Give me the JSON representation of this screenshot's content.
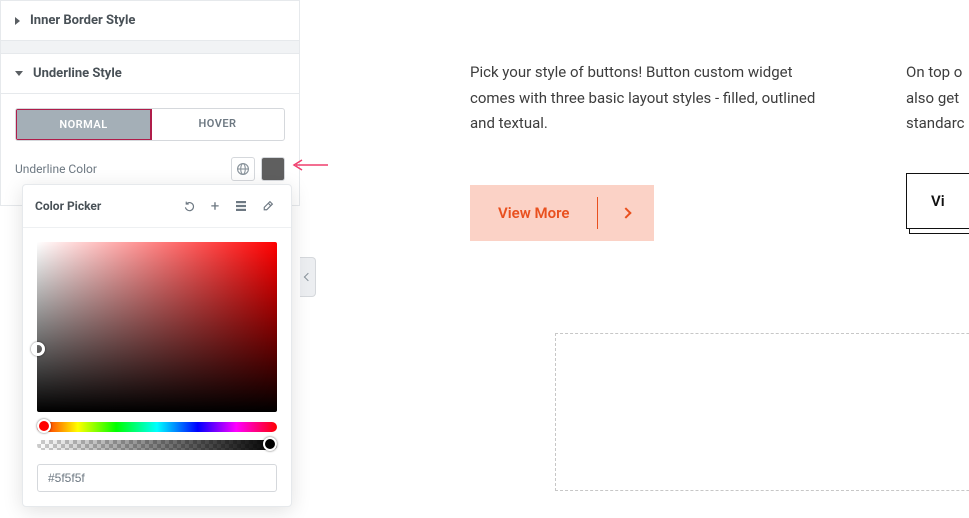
{
  "sidebar": {
    "section_inner_border": "Inner Border Style",
    "section_underline": "Underline Style",
    "tabs": {
      "normal": "NORMAL",
      "hover": "HOVER"
    },
    "underline_color_label": "Underline Color",
    "swatch_hex": "#5f5f5f"
  },
  "color_picker": {
    "title": "Color Picker",
    "hex_value": "#5f5f5f"
  },
  "preview": {
    "para1": "Pick your style of buttons! Button custom widget comes with three basic layout styles - filled, outlined and textual.",
    "para2_line1": "On top o",
    "para2_line2": "also get",
    "para2_line3": "standarc",
    "view_more": "View More",
    "view_more2": "Vi"
  }
}
